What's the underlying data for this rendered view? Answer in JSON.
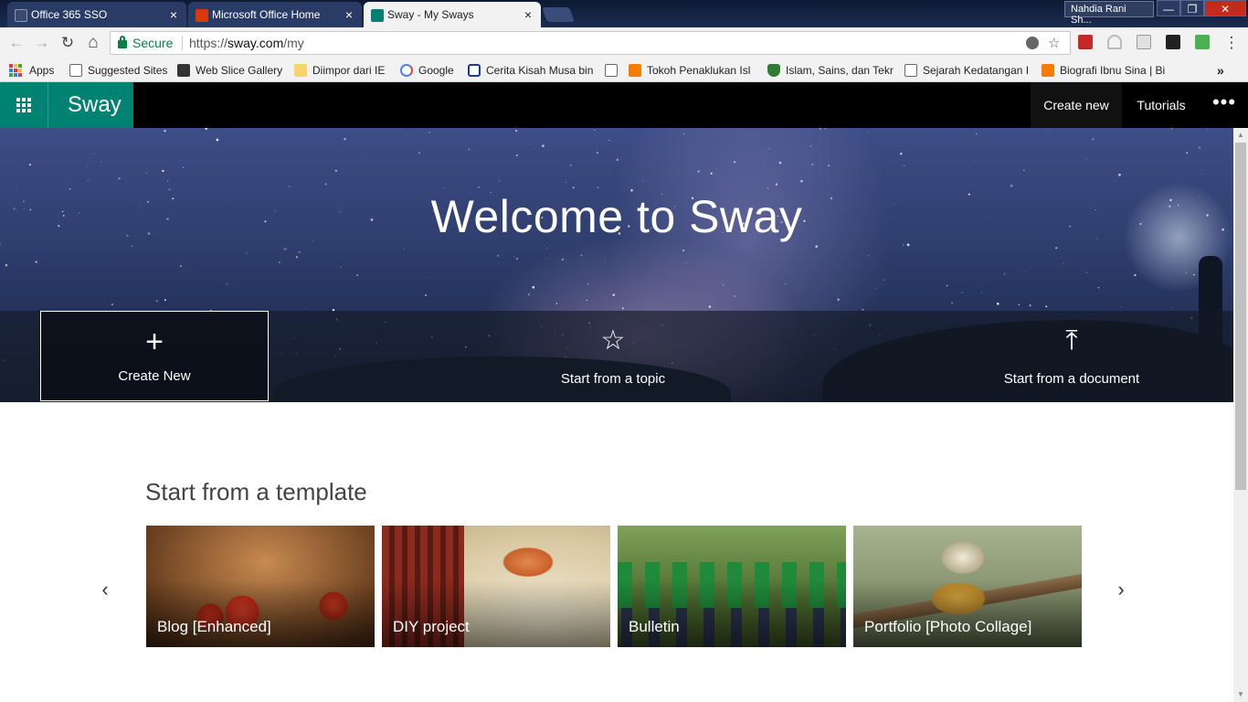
{
  "browser": {
    "tabs": [
      {
        "title": "Office 365 SSO",
        "close": "×"
      },
      {
        "title": "Microsoft Office Home",
        "close": "×"
      },
      {
        "title": "Sway - My Sways",
        "close": "×"
      }
    ],
    "profile_name": "Nahdia Rani Sh...",
    "window_buttons": {
      "minimize": "—",
      "restore": "❐",
      "close": "✕"
    },
    "nav": {
      "back": "←",
      "forward": "→",
      "reload": "↻",
      "home": "⌂"
    },
    "address": {
      "secure_label": "Secure",
      "url_scheme": "https://",
      "url_host": "sway.com",
      "url_path": "/my"
    },
    "star": "☆",
    "menu": "⋮",
    "bookmarks": [
      {
        "label": "Apps"
      },
      {
        "label": "Suggested Sites"
      },
      {
        "label": "Web Slice Gallery"
      },
      {
        "label": "Diimpor dari IE"
      },
      {
        "label": "Google"
      },
      {
        "label": "Cerita Kisah Musa bin"
      },
      {
        "label": "Tokoh Penaklukan Isl"
      },
      {
        "label": "Islam, Sains, dan Tekn"
      },
      {
        "label": "Sejarah Kedatangan I"
      },
      {
        "label": "Biografi Ibnu Sina | Bi"
      }
    ],
    "bookmarks_overflow": "»"
  },
  "app": {
    "brand": "Sway",
    "nav": {
      "create_new": "Create new",
      "tutorials": "Tutorials",
      "more": "•••"
    },
    "hero_title": "Welcome to Sway",
    "actions": [
      {
        "icon": "+",
        "label": "Create New"
      },
      {
        "icon": "☆",
        "label": "Start from a topic"
      },
      {
        "icon": "⤒",
        "label": "Start from a document"
      }
    ],
    "templates_title": "Start from a template",
    "carousel": {
      "prev": "‹",
      "next": "›"
    },
    "templates": [
      {
        "label": "Blog [Enhanced]"
      },
      {
        "label": "DIY project"
      },
      {
        "label": "Bulletin"
      },
      {
        "label": "Portfolio [Photo Collage]"
      }
    ]
  },
  "colors": {
    "brand": "#008272",
    "appbar": "#000000",
    "secure": "#0b8043"
  }
}
